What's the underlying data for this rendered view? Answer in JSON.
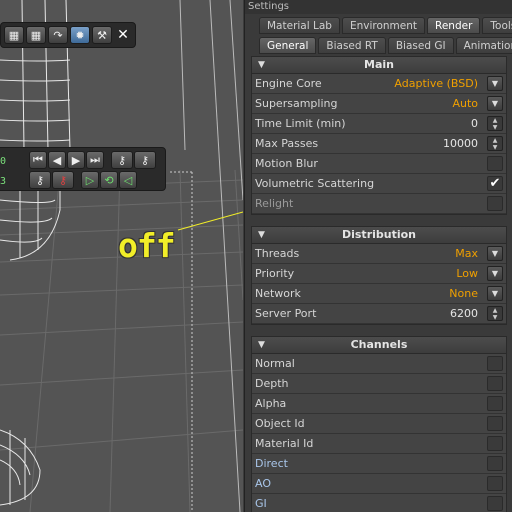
{
  "annotation": {
    "text": "off",
    "color": "#f2ee28"
  },
  "viewport": {
    "toolbar_icons": [
      "layout-icon",
      "layout-icon",
      "undo-icon",
      "render-icon",
      "tools-icon"
    ],
    "close_label": "✕",
    "frame_numbers": [
      "0",
      "3"
    ],
    "transport_icons": [
      "rewind-icon",
      "step-back-icon",
      "play-icon",
      "fast-forward-icon",
      "key-icon",
      "key-icon"
    ],
    "transport_icons_2": [
      "key-icon",
      "key-red-icon",
      "play-forward-icon",
      "loop-icon",
      "play-back-icon"
    ]
  },
  "panel": {
    "title": "Settings",
    "top_tabs": [
      "Material Lab",
      "Environment",
      "Render",
      "Tools"
    ],
    "top_tab_active": 2,
    "sub_tabs": [
      "General",
      "Biased RT",
      "Biased GI",
      "Animation"
    ],
    "sub_tab_active": 0,
    "main": {
      "title": "Main",
      "rows": [
        {
          "label": "Engine Core",
          "value": "Adaptive (BSD)",
          "control": "dropdown"
        },
        {
          "label": "Supersampling",
          "value": "Auto",
          "control": "dropdown"
        },
        {
          "label": "Time Limit (min)",
          "value": "0",
          "control": "spinner"
        },
        {
          "label": "Max Passes",
          "value": "10000",
          "control": "spinner"
        },
        {
          "label": "Motion Blur",
          "checked": false
        },
        {
          "label": "Volumetric Scattering",
          "checked": true
        },
        {
          "label": "Relight",
          "checked": false
        }
      ]
    },
    "distribution": {
      "title": "Distribution",
      "rows": [
        {
          "label": "Threads",
          "value": "Max",
          "control": "dropdown"
        },
        {
          "label": "Priority",
          "value": "Low",
          "control": "dropdown"
        },
        {
          "label": "Network",
          "value": "None",
          "control": "dropdown"
        },
        {
          "label": "Server Port",
          "value": "6200",
          "control": "spinner"
        }
      ]
    },
    "channels": {
      "title": "Channels",
      "rows": [
        {
          "label": "Normal",
          "checked": false
        },
        {
          "label": "Depth",
          "checked": false
        },
        {
          "label": "Alpha",
          "checked": false
        },
        {
          "label": "Object Id",
          "checked": false
        },
        {
          "label": "Material Id",
          "checked": false
        },
        {
          "label": "Direct",
          "checked": false
        },
        {
          "label": "AO",
          "checked": false
        },
        {
          "label": "GI",
          "checked": false
        }
      ]
    },
    "collapse_icon": "▼",
    "colors": {
      "accent_value": "#f0a000",
      "channel_label_blue": "#a9c6ea",
      "annotation": "#f2ee28"
    }
  }
}
